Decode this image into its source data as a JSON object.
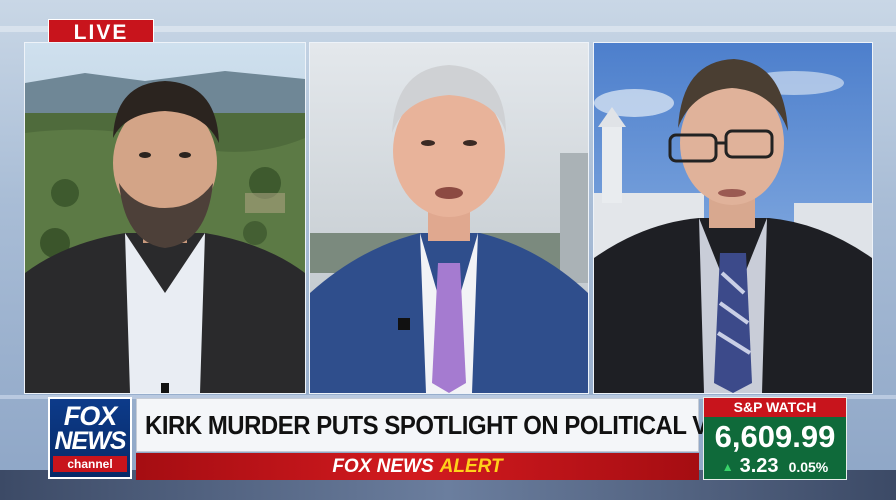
{
  "live_label": "LIVE",
  "logo": {
    "line1": "FOX",
    "line2": "NEWS",
    "line3": "channel"
  },
  "headline": "KIRK MURDER PUTS SPOTLIGHT ON POLITICAL VIOLENCE",
  "alert": {
    "brand": "FOX NEWS",
    "word": "ALERT"
  },
  "market": {
    "title": "S&P WATCH",
    "value": "6,609.99",
    "change_points": "3.23",
    "change_percent": "0.05%",
    "direction_icon": "triangle-up-icon"
  },
  "colors": {
    "live_red": "#c8141c",
    "fox_blue": "#0d3b8a",
    "market_green": "#0f6a3a",
    "alert_yellow": "#ffd11a"
  }
}
